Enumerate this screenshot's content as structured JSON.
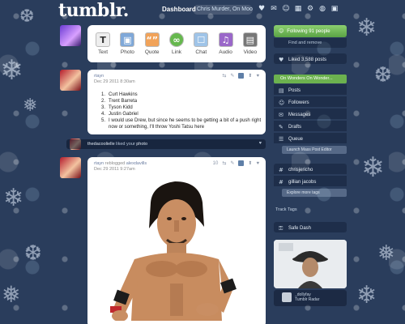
{
  "header": {
    "logo": "tumblr.",
    "dashboard": "Dashboard",
    "search": "Chris Murder, On Moonlight"
  },
  "composer": {
    "buttons": [
      {
        "label": "Text",
        "icon": "T"
      },
      {
        "label": "Photo",
        "icon": "▣"
      },
      {
        "label": "Quote",
        "icon": "“”"
      },
      {
        "label": "Link",
        "icon": "∞"
      },
      {
        "label": "Chat",
        "icon": "☐"
      },
      {
        "label": "Audio",
        "icon": "♫"
      },
      {
        "label": "Video",
        "icon": "▤"
      }
    ]
  },
  "post1": {
    "user": "rtayn",
    "date": "Dec 29 2011 8:30am",
    "list": [
      {
        "n": "1.",
        "text": "Curt Hawkins"
      },
      {
        "n": "2.",
        "text": "Trent Barreta"
      },
      {
        "n": "3.",
        "text": "Tyson Kidd"
      },
      {
        "n": "4.",
        "text": "Justin Gabriel"
      },
      {
        "n": "5.",
        "text": "I would use Drew, but since he seems to be getting a bit of a push right"
      },
      {
        "n": "",
        "text": "now or something, I'll throw Yoshi Tatsu here"
      }
    ]
  },
  "notes": {
    "user": "thedacoolielle",
    "text": "liked your",
    "link": "photo"
  },
  "post2": {
    "user": "rtayn",
    "reblogged": "reblogged",
    "source": "alexdavills",
    "date": "Dec 29 2011 9:27am",
    "count": "10"
  },
  "sidebar": {
    "follow": "Following 91 people",
    "find": "Find and remove",
    "liked": "Liked 3,588 posts",
    "blog": "On Wonders On Wonder...",
    "posts": "Posts",
    "followers": "Followers",
    "messages": "Messages",
    "drafts": "Drafts",
    "queue": "Queue",
    "launch": "Launch Mass Post Editor",
    "chris": "chrisjericho",
    "gillian": "gillian jacobs",
    "explore": "Explore more tags",
    "tracked": "Track Tags",
    "safe": "Safe Dash",
    "radar_user": "_dollyfay",
    "radar_label": "Tumblr Radar"
  }
}
